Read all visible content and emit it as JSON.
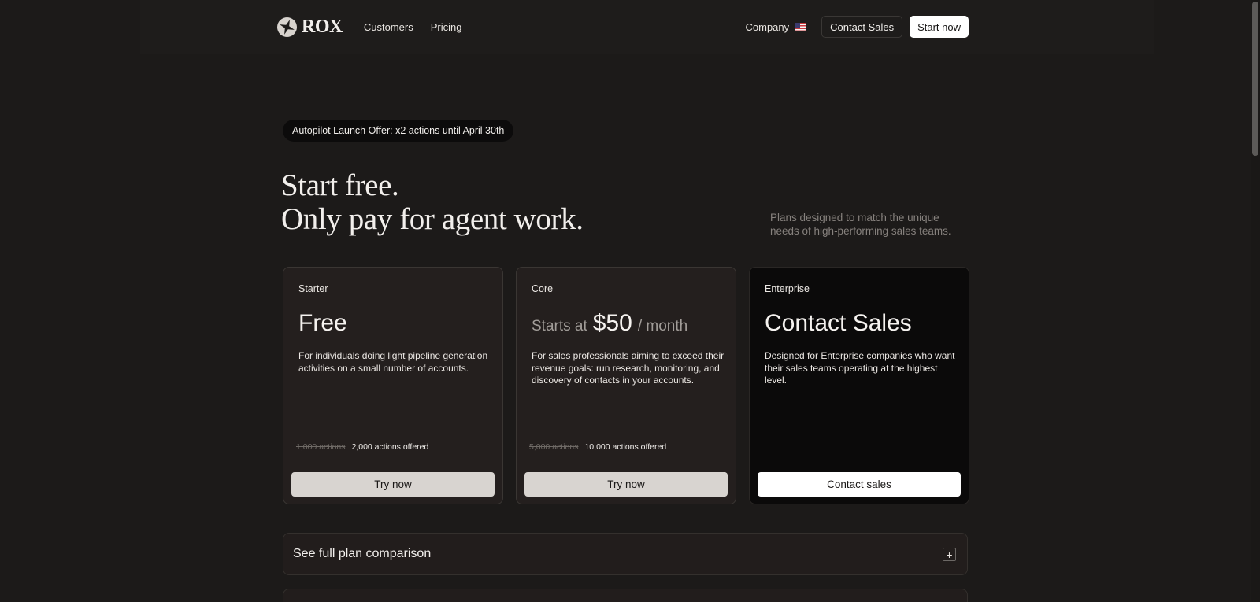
{
  "header": {
    "logo_text": "ROX",
    "nav": [
      {
        "label": "Customers"
      },
      {
        "label": "Pricing"
      }
    ],
    "company_label": "Company",
    "contact_sales_label": "Contact Sales",
    "start_now_label": "Start now"
  },
  "hero": {
    "offer_pill": "Autopilot Launch Offer: x2 actions until April 30th",
    "title_line1": "Start free.",
    "title_line2": "Only pay for agent work.",
    "subtitle": "Plans designed to match the unique needs of high-performing sales teams."
  },
  "plans": [
    {
      "tier": "Starter",
      "price": "Free",
      "description": "For individuals doing light pipeline generation activities on a small number of accounts.",
      "actions_old": "1,000 actions",
      "actions_new": "2,000 actions offered",
      "button": "Try now"
    },
    {
      "tier": "Core",
      "price_prefix": "Starts at",
      "price": "$50",
      "price_suffix": "/ month",
      "description": "For sales professionals aiming to exceed their revenue goals: run research, monitoring, and discovery of contacts in your accounts.",
      "actions_old": "5,000 actions",
      "actions_new": "10,000 actions offered",
      "button": "Try now"
    },
    {
      "tier": "Enterprise",
      "price": "Contact Sales",
      "description": "Designed for Enterprise companies who want their sales teams operating at the highest level.",
      "button": "Contact sales"
    }
  ],
  "comparison": {
    "label": "See full plan comparison",
    "toggle": "+"
  },
  "colors": {
    "background": "#1c1a19",
    "card": "#241f1e",
    "enterprise_card": "#0b0a0a",
    "text": "#f2efec",
    "muted": "#86817d"
  },
  "icons": {
    "logo": "four-point-star-icon",
    "flag": "us-flag-icon",
    "toggle": "plus-icon"
  }
}
